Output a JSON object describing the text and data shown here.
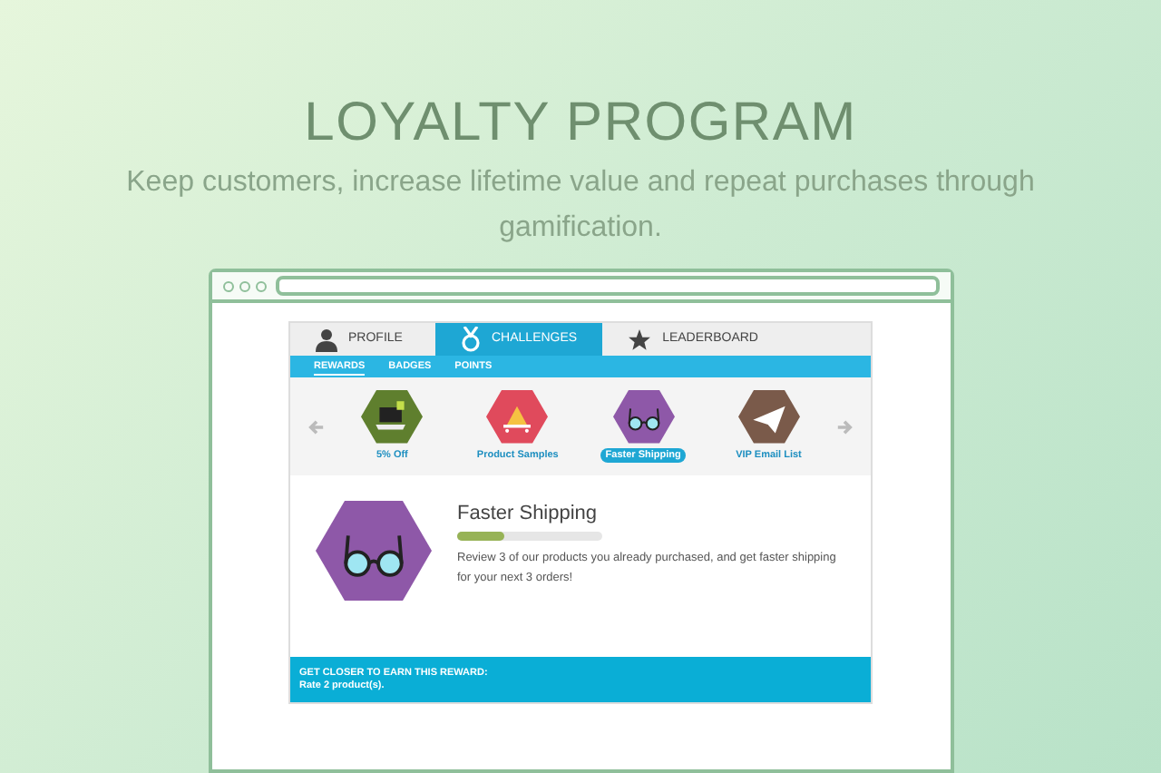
{
  "hero": {
    "title": "LOYALTY PROGRAM",
    "subtitle": "Keep customers, increase lifetime value and repeat purchases through gamification."
  },
  "tabs": [
    {
      "label": "PROFILE",
      "kind": "person",
      "selected": false
    },
    {
      "label": "CHALLENGES",
      "kind": "medal",
      "selected": true
    },
    {
      "label": "LEADERBOARD",
      "kind": "star",
      "selected": false
    }
  ],
  "subtabs": [
    {
      "label": "REWARDS",
      "selected": true
    },
    {
      "label": "BADGES",
      "selected": false
    },
    {
      "label": "POINTS",
      "selected": false
    }
  ],
  "rewards": [
    {
      "label": "5% Off",
      "kind": "laptop",
      "color": "#5f7f2e",
      "selected": false
    },
    {
      "label": "Product Samples",
      "kind": "cart",
      "color": "#e04a5c",
      "selected": false
    },
    {
      "label": "Faster Shipping",
      "kind": "glasses",
      "color": "#8e58a8",
      "selected": true
    },
    {
      "label": "VIP Email List",
      "kind": "plane",
      "color": "#7a5a4a",
      "selected": false
    }
  ],
  "detail": {
    "title": "Faster Shipping",
    "kind": "glasses",
    "color": "#8e58a8",
    "level": 0.33,
    "description": "Review 3 of our products you already purchased, and get faster shipping for your next 3 orders!"
  },
  "footer": {
    "heading": "GET CLOSER TO EARN THIS REWARD:",
    "text": "Rate 2 product(s)."
  }
}
